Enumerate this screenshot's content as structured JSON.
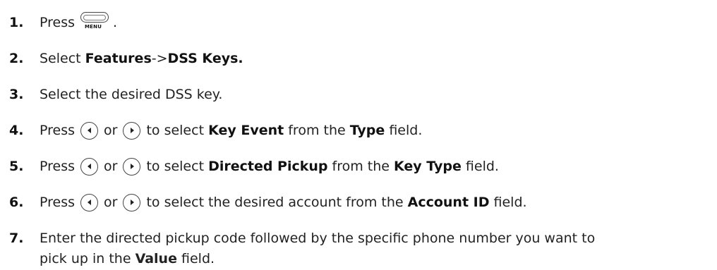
{
  "steps": [
    {
      "num": "1.",
      "t1": "Press",
      "key_label": "MENU",
      "t2": "."
    },
    {
      "num": "2.",
      "t1": "Select ",
      "b1": "Features",
      "t2": "->",
      "b2": "DSS Keys."
    },
    {
      "num": "3.",
      "t1": "Select the desired DSS key."
    },
    {
      "num": "4.",
      "t1": "Press",
      "or": "or",
      "t2": "to select ",
      "b1": "Key Event",
      "t3": " from the ",
      "b2": "Type",
      "t4": " field."
    },
    {
      "num": "5.",
      "t1": "Press",
      "or": "or",
      "t2": "to select ",
      "b1": "Directed Pickup",
      "t3": " from the ",
      "b2": "Key Type",
      "t4": " field."
    },
    {
      "num": "6.",
      "t1": "Press",
      "or": "or",
      "t2": "to select the desired account from the ",
      "b1": "Account ID",
      "t3": " field."
    },
    {
      "num": "7.",
      "t1": "Enter the directed pickup code followed by the specific phone number you want to",
      "t2": "pick up in the ",
      "b1": "Value",
      "t3": " field."
    }
  ]
}
